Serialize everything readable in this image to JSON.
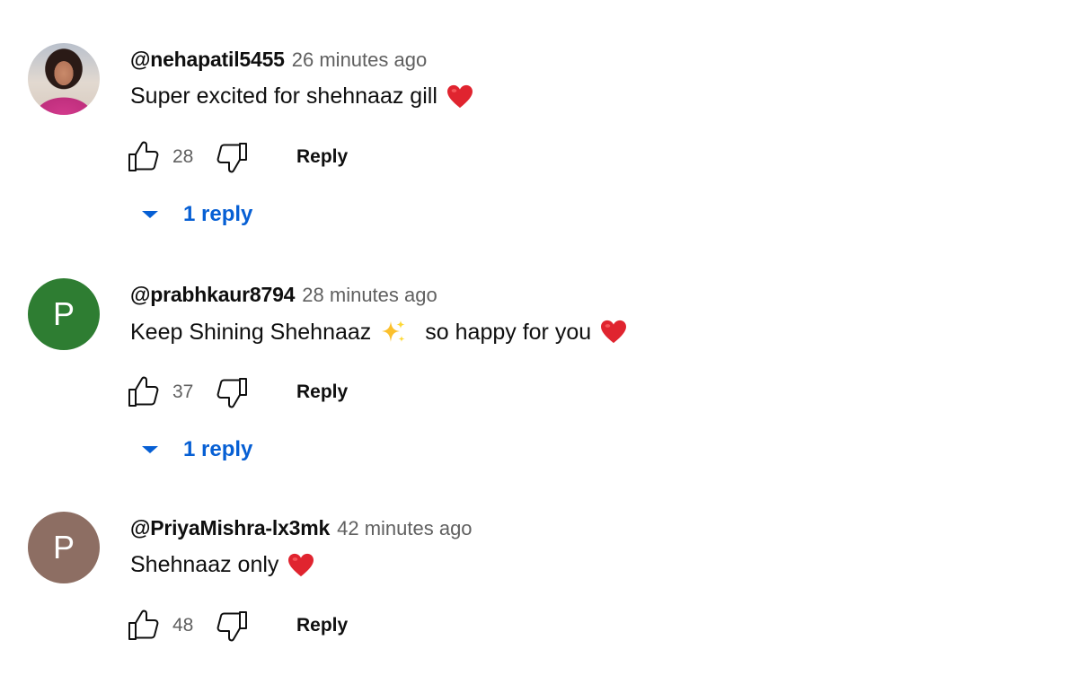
{
  "comments": [
    {
      "avatar": {
        "type": "photo",
        "letter": "",
        "color": ""
      },
      "username": "@nehapatil5455",
      "timestamp": "26 minutes ago",
      "text_parts": [
        "Super excited for shehnaaz gill"
      ],
      "emojis": [
        "heart"
      ],
      "likes": "28",
      "reply_label": "Reply",
      "replies_label": "1 reply"
    },
    {
      "avatar": {
        "type": "letter",
        "letter": "P",
        "color": "#2e7d32"
      },
      "username": "@prabhkaur8794",
      "timestamp": "28 minutes ago",
      "text_parts": [
        "Keep Shining Shehnaaz",
        "so happy for you"
      ],
      "emojis": [
        "sparkles",
        "heart"
      ],
      "likes": "37",
      "reply_label": "Reply",
      "replies_label": "1 reply"
    },
    {
      "avatar": {
        "type": "letter",
        "letter": "P",
        "color": "#8d6e63"
      },
      "username": "@PriyaMishra-lx3mk",
      "timestamp": "42 minutes ago",
      "text_parts": [
        "Shehnaaz only"
      ],
      "emojis": [
        "heart"
      ],
      "likes": "48",
      "reply_label": "Reply",
      "replies_label": ""
    }
  ],
  "colors": {
    "link_blue": "#065fd4",
    "meta_gray": "#606060",
    "heart_red": "#e0242f",
    "sparkle_yellow": "#fbc02d"
  }
}
